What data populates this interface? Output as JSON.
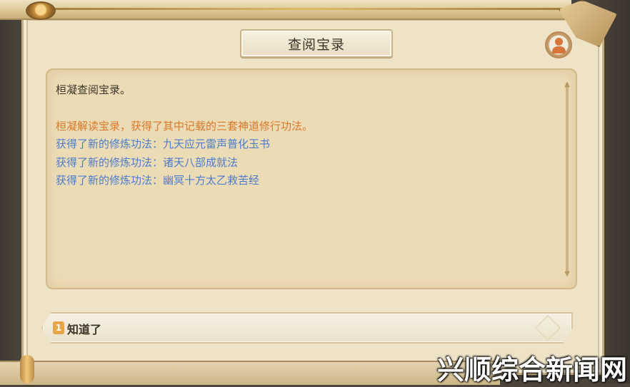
{
  "dialog": {
    "title": "查阅宝录",
    "avatar_icon": "person-icon",
    "lines": {
      "intro": "桓凝查阅宝录。",
      "summary": "桓凝解读宝录，获得了其中记载的三套神道修行功法。",
      "method1": "获得了新的修炼功法：九天应元雷声普化玉书",
      "method2": "获得了新的修炼功法：诸天八部成就法",
      "method3": "获得了新的修炼功法：幽冥十方太乙救苦经"
    },
    "colors": {
      "intro": "#3b3429",
      "summary": "#d9782a",
      "method": "#4b7ccd"
    }
  },
  "options": [
    {
      "number": "1",
      "label": "知道了"
    }
  ],
  "watermark": "兴顺综合新闻网"
}
